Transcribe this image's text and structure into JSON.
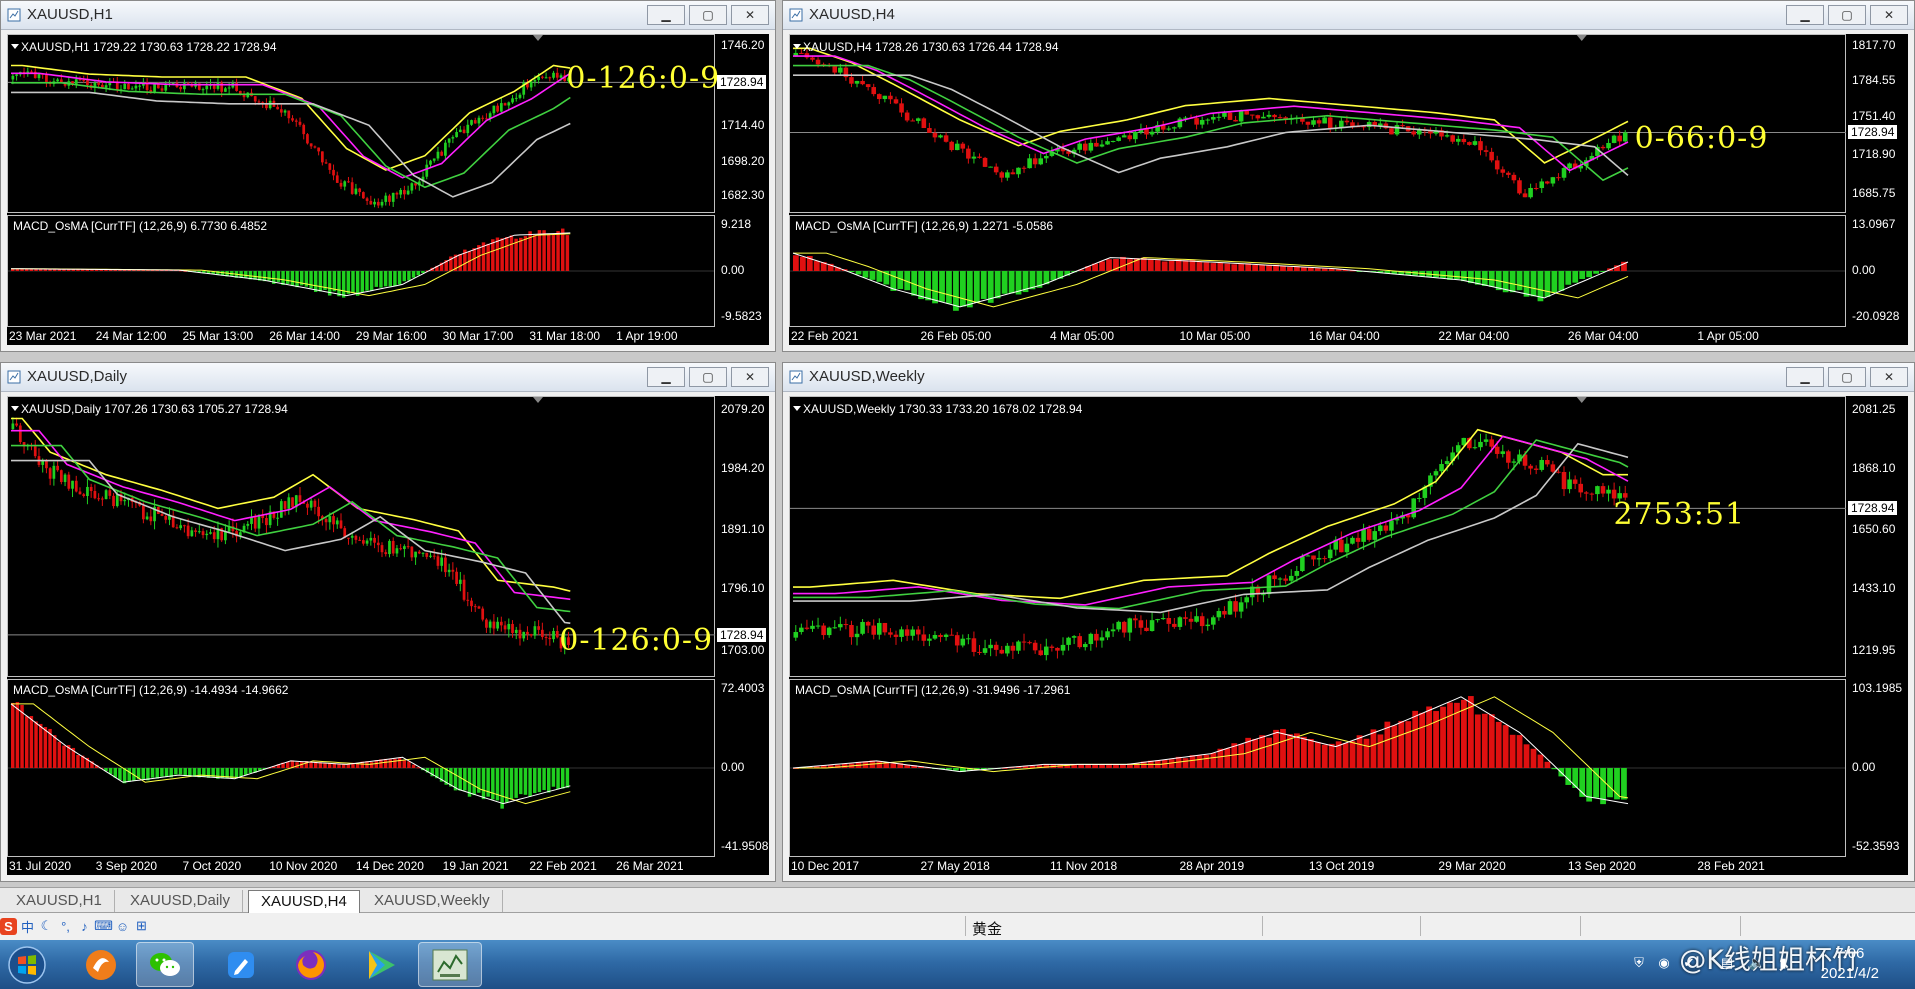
{
  "windows": [
    {
      "id": "h1",
      "title": "XAUUSD,H1",
      "ohlc": "XAUUSD,H1  1729.22 1730.63 1728.22 1728.94",
      "macd_label": "MACD_OsMA [CurrTF] (12,26,9) 6.7730 6.4852",
      "big_text": "0-126:0-9",
      "price_box": "1728.94",
      "price_ticks": [
        "1746.20",
        "1714.40",
        "1698.20",
        "1682.30"
      ],
      "macd_ticks": [
        "9.218",
        "0.00",
        "-9.5823"
      ],
      "x_ticks": [
        "23 Mar 2021",
        "24 Mar 12:00",
        "25 Mar 13:00",
        "26 Mar 14:00",
        "29 Mar 16:00",
        "30 Mar 17:00",
        "31 Mar 18:00",
        "1 Apr 19:00"
      ]
    },
    {
      "id": "h4",
      "title": "XAUUSD,H4",
      "ohlc": "XAUUSD,H4  1728.26 1730.63 1726.44 1728.94",
      "macd_label": "MACD_OsMA [CurrTF] (12,26,9) 1.2271 -5.0586",
      "big_text": "0-66:0-9",
      "price_box": "1728.94",
      "price_ticks": [
        "1817.70",
        "1784.55",
        "1751.40",
        "1718.90",
        "1685.75"
      ],
      "macd_ticks": [
        "13.0967",
        "0.00",
        "-20.0928"
      ],
      "x_ticks": [
        "22 Feb 2021",
        "26 Feb 05:00",
        "4 Mar 05:00",
        "10 Mar 05:00",
        "16 Mar 04:00",
        "22 Mar 04:00",
        "26 Mar 04:00",
        "1 Apr 05:00"
      ]
    },
    {
      "id": "d1",
      "title": "XAUUSD,Daily",
      "ohlc": "XAUUSD,Daily  1707.26 1730.63 1705.27 1728.94",
      "macd_label": "MACD_OsMA [CurrTF] (12,26,9) -14.4934 -14.9662",
      "big_text": "0-126:0-9",
      "price_box": "1728.94",
      "price_ticks": [
        "2079.20",
        "1984.20",
        "1891.10",
        "1796.10",
        "1703.00"
      ],
      "macd_ticks": [
        "72.4003",
        "0.00",
        "-41.9508"
      ],
      "x_ticks": [
        "31 Jul 2020",
        "3 Sep 2020",
        "7 Oct 2020",
        "10 Nov 2020",
        "14 Dec 2020",
        "19 Jan 2021",
        "22 Feb 2021",
        "26 Mar 2021"
      ]
    },
    {
      "id": "w1",
      "title": "XAUUSD,Weekly",
      "ohlc": "XAUUSD,Weekly  1730.33 1733.20 1678.02 1728.94",
      "macd_label": "MACD_OsMA [CurrTF] (12,26,9) -31.9496 -17.2961",
      "big_text": "2753:51",
      "price_box": "1728.94",
      "price_ticks": [
        "2081.25",
        "1868.10",
        "1650.60",
        "1433.10",
        "1219.95"
      ],
      "macd_ticks": [
        "103.1985",
        "0.00",
        "-52.3593"
      ],
      "x_ticks": [
        "10 Dec 2017",
        "27 May 2018",
        "11 Nov 2018",
        "28 Apr 2019",
        "13 Oct 2019",
        "29 Mar 2020",
        "13 Sep 2020",
        "28 Feb 2021"
      ]
    }
  ],
  "tabs": [
    "XAUUSD,H1",
    "XAUUSD,Daily",
    "XAUUSD,H4",
    "XAUUSD,Weekly"
  ],
  "active_tab": "XAUUSD,H4",
  "status": {
    "symbol_name": "黄金"
  },
  "taskbar": {
    "time": "7:06",
    "date": "2021/4/2",
    "watermark": "@K线姐姐杯竹"
  },
  "colors": {
    "chart_bg": "#000000",
    "bull": "#20d020",
    "bear": "#e01010",
    "ma_yellow": "#ffff40",
    "ma_magenta": "#ff20ff",
    "ma_green": "#40d040",
    "ma_gray": "#c8c8c8"
  }
}
